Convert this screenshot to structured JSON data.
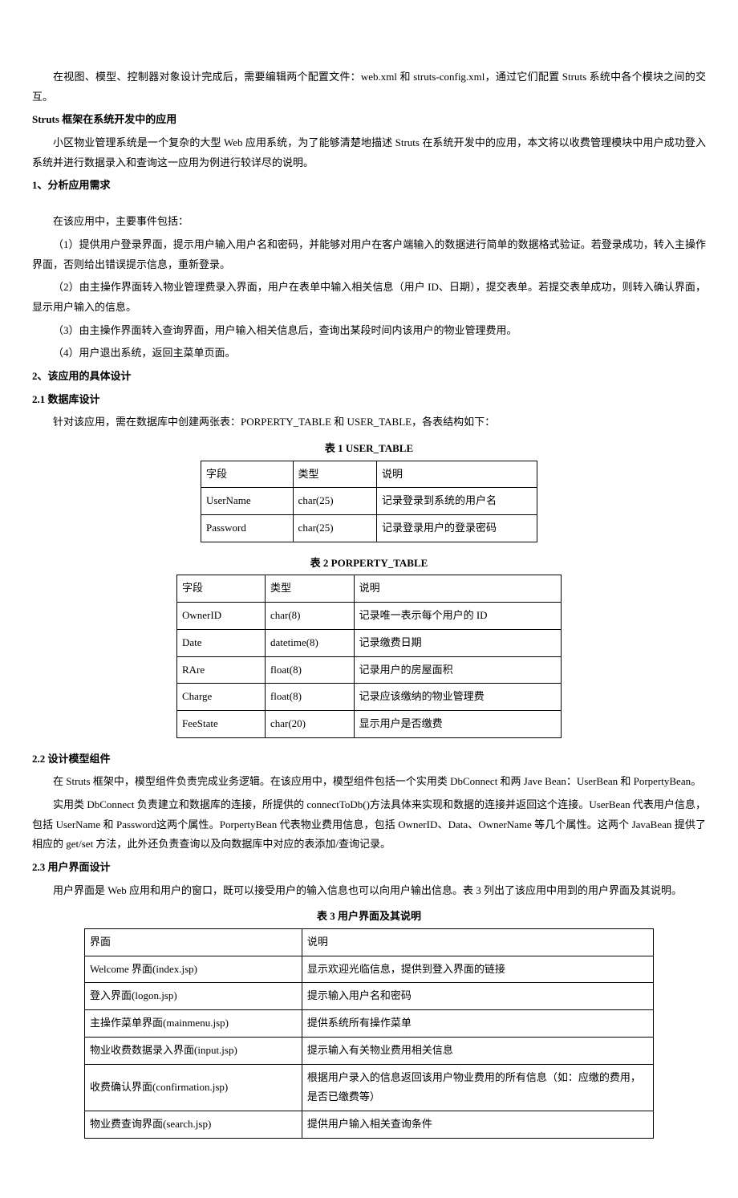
{
  "p1": "在视图、模型、控制器对象设计完成后，需要编辑两个配置文件：web.xml 和 struts-config.xml，通过它们配置 Struts 系统中各个模块之间的交互。",
  "h1": "Struts 框架在系统开发中的应用",
  "p2": "小区物业管理系统是一个复杂的大型 Web 应用系统，为了能够清楚地描述 Struts 在系统开发中的应用，本文将以收费管理模块中用户成功登入系统并进行数据录入和查询这一应用为例进行较详尽的说明。",
  "h2": "1、分析应用需求",
  "p3": "在该应用中，主要事件包括：",
  "p4": "（1）提供用户登录界面，提示用户输入用户名和密码，并能够对用户在客户端输入的数据进行简单的数据格式验证。若登录成功，转入主操作界面，否则给出错误提示信息，重新登录。",
  "p5": "（2）由主操作界面转入物业管理费录入界面，用户在表单中输入相关信息（用户 ID、日期），提交表单。若提交表单成功，则转入确认界面，显示用户输入的信息。",
  "p6": "（3）由主操作界面转入查询界面，用户输入相关信息后，查询出某段时间内该用户的物业管理费用。",
  "p7": "（4）用户退出系统，返回主菜单页面。",
  "h3": "2、该应用的具体设计",
  "h4": "2.1  数据库设计",
  "p8": "针对该应用，需在数据库中创建两张表：PORPERTY_TABLE 和 USER_TABLE，各表结构如下：",
  "tc1": "表 1   USER_TABLE",
  "t1": {
    "h": {
      "c1": "字段",
      "c2": "类型",
      "c3": "说明"
    },
    "r1": {
      "c1": "UserName",
      "c2": "char(25)",
      "c3": "记录登录到系统的用户名"
    },
    "r2": {
      "c1": "Password",
      "c2": "char(25)",
      "c3": "记录登录用户的登录密码"
    }
  },
  "tc2": "表 2  PORPERTY_TABLE",
  "t2": {
    "h": {
      "c1": "字段",
      "c2": "类型",
      "c3": "说明"
    },
    "r1": {
      "c1": "OwnerID",
      "c2": "char(8)",
      "c3": "记录唯一表示每个用户的 ID"
    },
    "r2": {
      "c1": "Date",
      "c2": "datetime(8)",
      "c3": "记录缴费日期"
    },
    "r3": {
      "c1": "RAre",
      "c2": "float(8)",
      "c3": "记录用户的房屋面积"
    },
    "r4": {
      "c1": "Charge",
      "c2": "float(8)",
      "c3": "记录应该缴纳的物业管理费"
    },
    "r5": {
      "c1": "FeeState",
      "c2": "char(20)",
      "c3": "显示用户是否缴费"
    }
  },
  "h5": "2.2  设计模型组件",
  "p9": "在 Struts 框架中，模型组件负责完成业务逻辑。在该应用中，模型组件包括一个实用类 DbConnect 和两 Jave Bean：UserBean 和 PorpertyBean。",
  "p10": "实用类 DbConnect 负责建立和数据库的连接，所提供的 connectToDb()方法具体来实现和数据的连接并返回这个连接。UserBean 代表用户信息，包括 UserName 和 Password这两个属性。PorpertyBean 代表物业费用信息，包括 OwnerID、Data、OwnerName 等几个属性。这两个 JavaBean 提供了相应的 get/set 方法，此外还负责查询以及向数据库中对应的表添加/查询记录。",
  "h6": "2.3  用户界面设计",
  "p11": "用户界面是 Web 应用和用户的窗口，既可以接受用户的输入信息也可以向用户输出信息。表 3 列出了该应用中用到的用户界面及其说明。",
  "tc3": "表 3  用户界面及其说明",
  "t3": {
    "h": {
      "c1": "界面",
      "c2": "说明"
    },
    "r1": {
      "c1": "Welcome 界面(index.jsp)",
      "c2": "显示欢迎光临信息，提供到登入界面的链接"
    },
    "r2": {
      "c1": "登入界面(logon.jsp)",
      "c2": "提示输入用户名和密码"
    },
    "r3": {
      "c1": "主操作菜单界面(mainmenu.jsp)",
      "c2": "提供系统所有操作菜单"
    },
    "r4": {
      "c1": "物业收费数据录入界面(input.jsp)",
      "c2": "提示输入有关物业费用相关信息"
    },
    "r5": {
      "c1": "收费确认界面(confirmation.jsp)",
      "c2": "根据用户录入的信息返回该用户物业费用的所有信息（如：应缴的费用，是否已缴费等）"
    },
    "r6": {
      "c1": "物业费查询界面(search.jsp)",
      "c2": "提供用户输入相关查询条件"
    }
  }
}
